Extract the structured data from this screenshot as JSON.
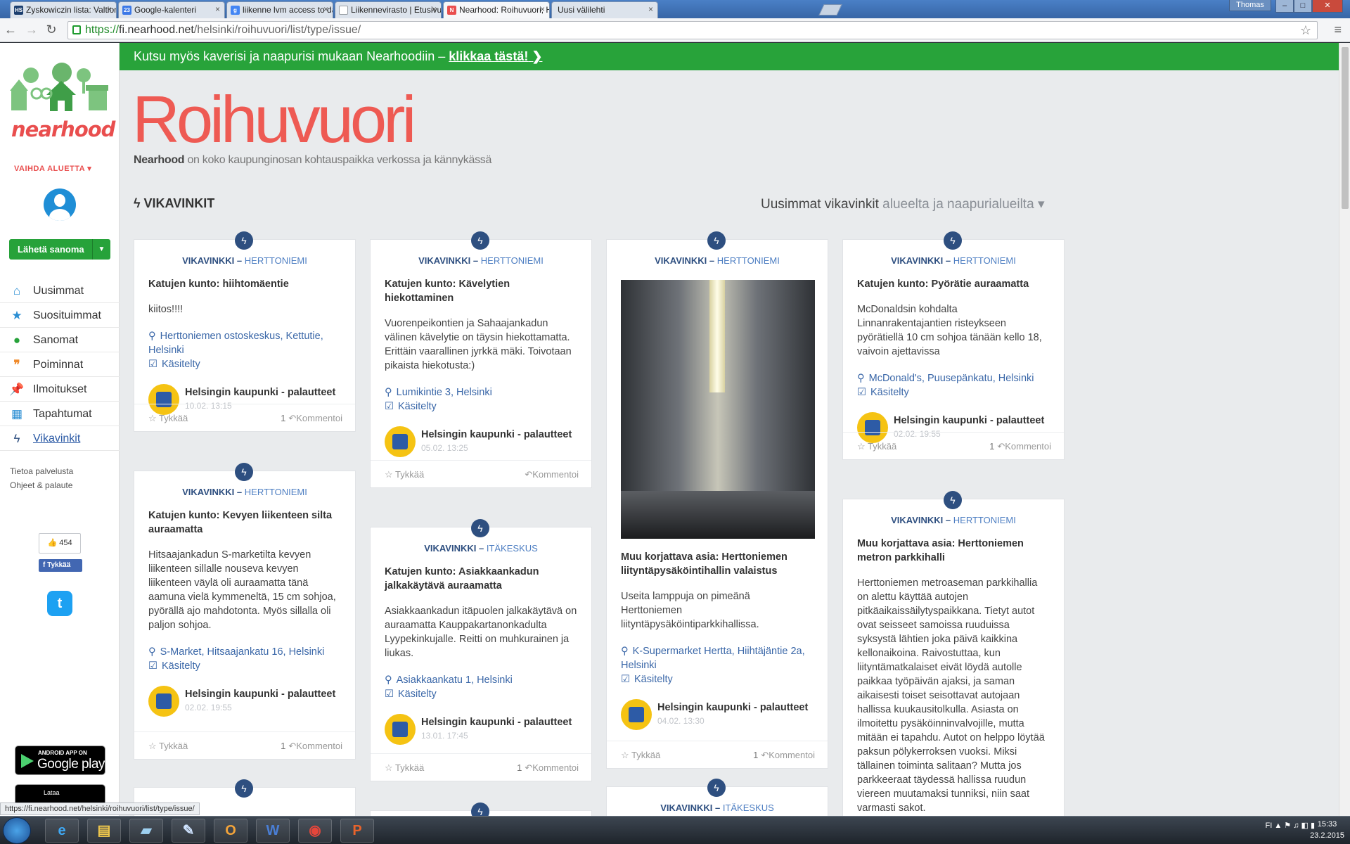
{
  "browser": {
    "tabs": [
      {
        "label": "Zyskowiczin lista: Valtionti",
        "icon": "hs-icon",
        "color": "#1b3e6e",
        "glyph": "HS"
      },
      {
        "label": "Google-kalenteri",
        "icon": "calendar-icon",
        "color": "#3b78e7",
        "glyph": "23"
      },
      {
        "label": "liikenne lvm access to dat",
        "icon": "google-icon",
        "color": "#4285f4",
        "glyph": "g"
      },
      {
        "label": "Liikennevirasto | Etusivu",
        "icon": "document-icon",
        "color": "#9aa0a6",
        "glyph": ""
      },
      {
        "label": "Nearhood: Roihuvuori, He",
        "icon": "nearhood-icon",
        "color": "#e94e4e",
        "glyph": "N"
      },
      {
        "label": "Uusi välilehti",
        "icon": "",
        "color": "",
        "glyph": ""
      }
    ],
    "user": "Thomas",
    "url_scheme": "https://",
    "url_host": "fi.nearhood.net",
    "url_path": "/helsinki/roihuvuori/list/type/issue/",
    "status_url": "https://fi.nearhood.net/helsinki/roihuvuori/list/type/issue/"
  },
  "sidebar": {
    "logo_text": "nearhood",
    "change_area": "VAIHDA ALUETTA",
    "send_button": "Lähetä sanoma",
    "nav": [
      {
        "label": "Uusimmat",
        "icon": "home-icon",
        "color": "#2b8ed3"
      },
      {
        "label": "Suosituimmat",
        "icon": "star-icon",
        "color": "#2b8ed3"
      },
      {
        "label": "Sanomat",
        "icon": "speech-bubble-icon",
        "color": "#27a23a"
      },
      {
        "label": "Poiminnat",
        "icon": "quote-icon",
        "color": "#f08a2b"
      },
      {
        "label": "Ilmoitukset",
        "icon": "pin-icon",
        "color": "#e94e4e"
      },
      {
        "label": "Tapahtumat",
        "icon": "calendar-icon",
        "color": "#2b8ed3"
      },
      {
        "label": "Vikavinkit",
        "icon": "bolt-icon",
        "color": "#2e4f80"
      }
    ],
    "links": [
      "Tietoa palvelusta",
      "Ohjeet & palaute"
    ],
    "fb_count": "454",
    "fb_like": "Tykkää",
    "google_play_small": "ANDROID APP ON",
    "google_play_big": "Google play",
    "appstore_small": "Lataa"
  },
  "main": {
    "banner_text": "Kutsu myös kaverisi ja naapurisi mukaan Nearhoodiin –",
    "banner_link": "klikkaa tästä!",
    "title": "Roihuvuori",
    "subtitle_brand": "Nearhood",
    "subtitle_rest": "on koko kaupunginosan kohtauspaikka verkossa ja kännykässä",
    "section_title": "VIKAVINKIT",
    "sort_label": "Uusimmat vikavinkit",
    "sort_select": "alueelta ja naapurialueilta"
  },
  "cards": [
    {
      "type": "VIKAVINKKI",
      "area": "HERTTONIEMI",
      "title": "Katujen kunto: hiihtomäentie",
      "body": "kiitos!!!!",
      "location": "Herttoniemen ostoskeskus, Kettutie, Helsinki",
      "status": "Käsitelty",
      "author": "Helsingin kaupunki - palautteet",
      "date": "10.02. 13:15",
      "like": "Tykkää",
      "comment_count": "1",
      "comment": "Kommentoi"
    },
    {
      "type": "VIKAVINKKI",
      "area": "HERTTONIEMI",
      "title": "Katujen kunto: Kevyen liikenteen silta auraamatta",
      "body": "Hitsaajankadun S-marketilta kevyen liikenteen sillalle nouseva kevyen liikenteen väylä oli auraamatta tänä aamuna vielä kymmeneltä, 15 cm sohjoa, pyörällä ajo mahdotonta. Myös sillalla oli paljon sohjoa.",
      "location": "S-Market, Hitsaajankatu 16, Helsinki",
      "status": "Käsitelty",
      "author": "Helsingin kaupunki - palautteet",
      "date": "02.02. 19:55",
      "like": "Tykkää",
      "comment_count": "1",
      "comment": "Kommentoi"
    },
    {
      "type": "VIKAVINKKI",
      "area": "HERTTONIEMI",
      "title": "Katujen kunto: Kävelytien hiekottaminen",
      "body": "Vuorenpeikontien ja Sahaajankadun välinen kävelytie on täysin hiekottamatta. Erittäin vaarallinen jyrkkä mäki. Toivotaan pikaista hiekotusta:)",
      "location": "Lumikintie 3, Helsinki",
      "status": "Käsitelty",
      "author": "Helsingin kaupunki - palautteet",
      "date": "05.02. 13:25",
      "like": "Tykkää",
      "comment_count": "",
      "comment": "Kommentoi"
    },
    {
      "type": "VIKAVINKKI",
      "area": "ITÄKESKUS",
      "title": "Katujen kunto: Asiakkaankadun jalkakäytävä auraamatta",
      "body": "Asiakkaankadun itäpuolen jalkakäytävä on auraamatta Kauppakartanonkadulta Lyypekinkujalle. Reitti on muhkurainen ja liukas.",
      "location": "Asiakkaankatu 1, Helsinki",
      "status": "Käsitelty",
      "author": "Helsingin kaupunki - palautteet",
      "date": "13.01. 17:45",
      "like": "Tykkää",
      "comment_count": "1",
      "comment": "Kommentoi"
    },
    {
      "type": "VIKAVINKKI",
      "area": "HERTTONIEMI",
      "title": "Muu korjattava asia: Herttoniemen liityntäpysäköintihallin valaistus",
      "body": "Useita lamppuja on pimeänä Herttoniemen liityntäpysäköintiparkkihallissa.",
      "location": "K-Supermarket Hertta, Hiihtäjäntie 2a, Helsinki",
      "status": "Käsitelty",
      "author": "Helsingin kaupunki - palautteet",
      "date": "04.02. 13:30",
      "like": "Tykkää",
      "comment_count": "1",
      "comment": "Kommentoi"
    },
    {
      "type": "VIKAVINKKI",
      "area": "ITÄKESKUS"
    },
    {
      "type": "VIKAVINKKI",
      "area": "HERTTONIEMI",
      "title": "Katujen kunto: Pyörätie auraamatta",
      "body": "McDonaldsin kohdalta Linnanrakentajantien risteykseen pyörätiellä 10 cm sohjoa tänään kello 18, vaivoin ajettavissa",
      "location": "McDonald's, Puusepänkatu, Helsinki",
      "status": "Käsitelty",
      "author": "Helsingin kaupunki - palautteet",
      "date": "02.02. 19:55",
      "like": "Tykkää",
      "comment_count": "1",
      "comment": "Kommentoi"
    },
    {
      "type": "VIKAVINKKI",
      "area": "HERTTONIEMI",
      "title": "Muu korjattava asia: Herttoniemen metron parkkihalli",
      "body": "Herttoniemen metroaseman parkkihallia on alettu käyttää autojen pitkäaikaissäilytyspaikkana. Tietyt autot ovat seisseet samoissa ruuduissa syksystä lähtien joka päivä kaikkina kellonaikoina. Raivostuttaa, kun liityntämatkalaiset eivät löydä autolle paikkaa työpäivän ajaksi, ja saman aikaisesti toiset seisottavat autojaan hallissa kuukausitolkulla. Asiasta on ilmoitettu pysäköinninvalvojille, mutta mitään ei tapahdu. Autot on helppo löytää paksun pölykerroksen vuoksi. Miksi tällainen toiminta salitaan? Mutta jos parkkeeraat täydessä hallissa ruudun viereen muutamaksi tunniksi, niin saat varmasti sakot."
    }
  ],
  "taskbar": {
    "apps": [
      "ie-icon",
      "explorer-icon",
      "files-icon",
      "paint-icon",
      "outlook-icon",
      "word-icon",
      "chrome-icon",
      "powerpoint-icon"
    ],
    "lang": "FI",
    "time": "15:33",
    "date": "23.2.2015"
  }
}
